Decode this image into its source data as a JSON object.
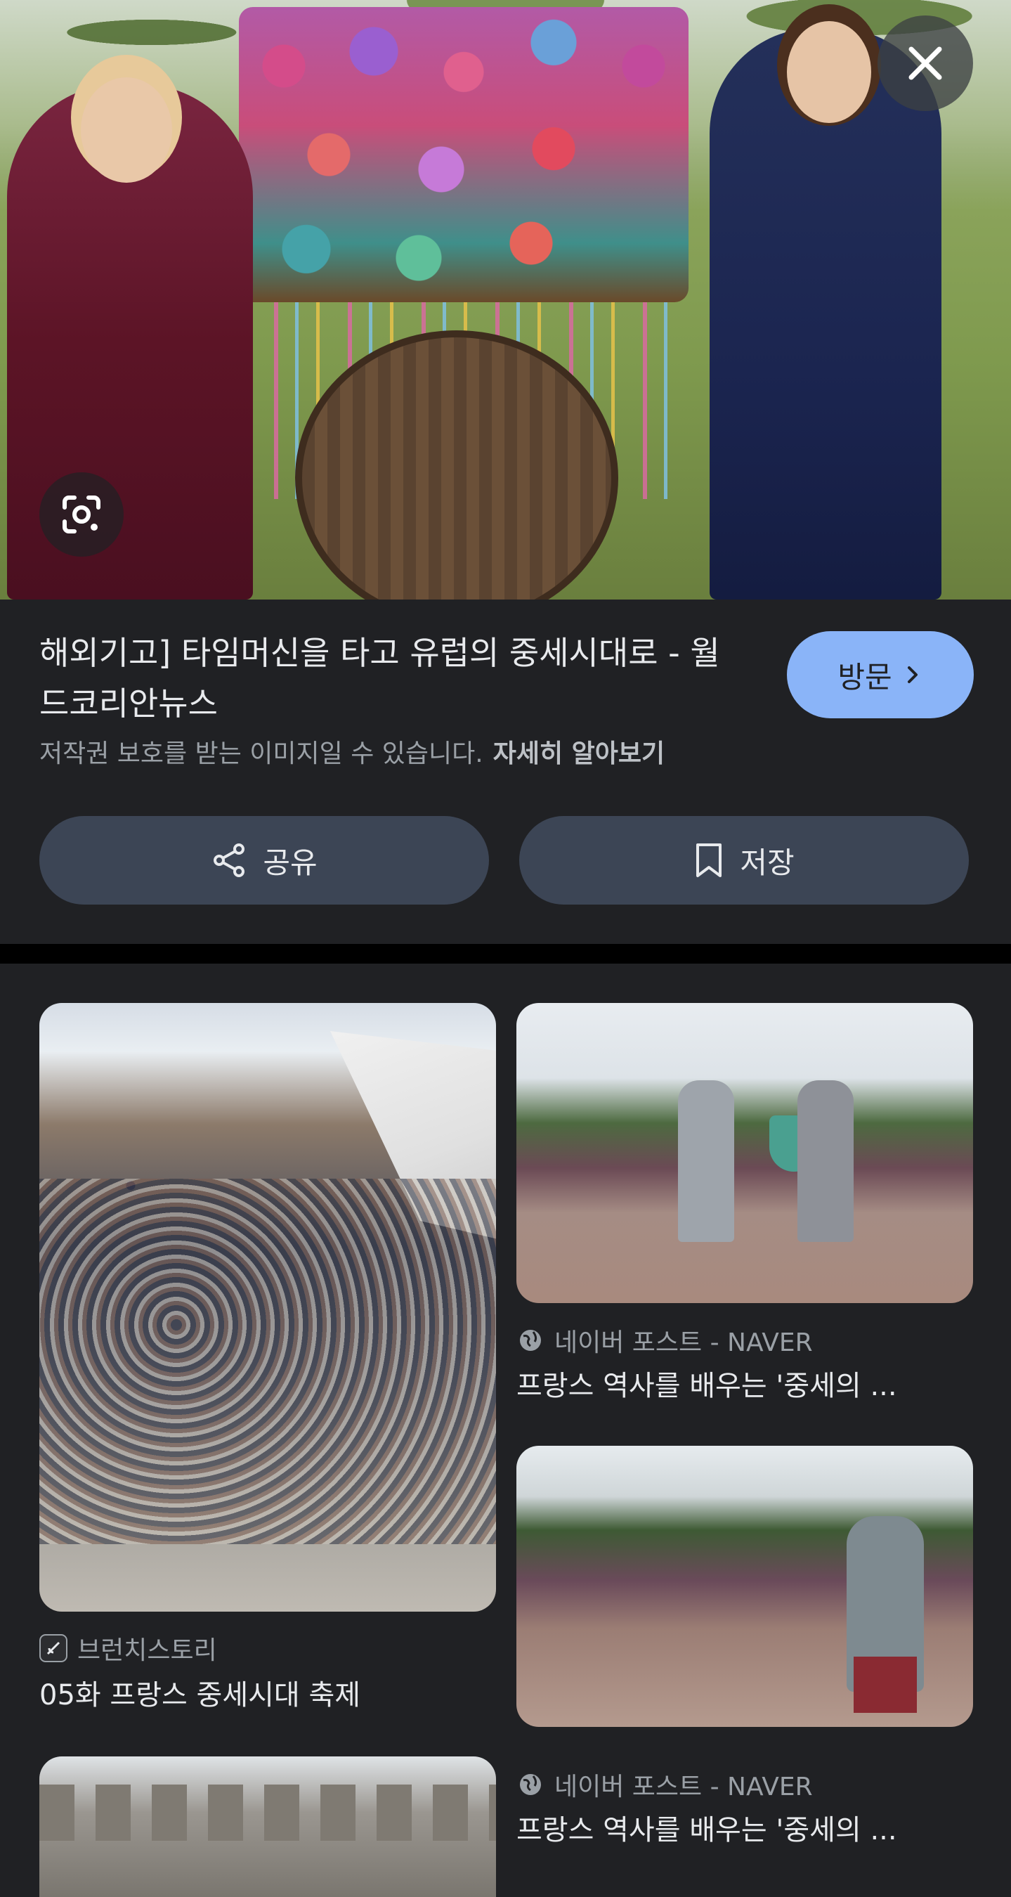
{
  "hero": {
    "description_icons": {
      "lens": "google-lens-icon",
      "close": "close-icon"
    }
  },
  "result": {
    "title": "해외기고] 타임머신을 타고 유럽의 중세시대로 - 월드코리안뉴스",
    "copyright": "저작권 보호를 받는 이미지일 수 있습니다.",
    "learn_more": "자세히 알아보기",
    "visit_label": "방문",
    "share_label": "공유",
    "save_label": "저장"
  },
  "related": [
    {
      "source": "브런치스토리",
      "caption": "05화 프랑스 중세시대 축제"
    },
    {
      "source": "네이버 포스트 - NAVER",
      "caption": "프랑스 역사를 배우는 '중세의 ..."
    },
    {
      "source": "네이버 포스트 - NAVER",
      "caption": "프랑스 역사를 배우는 '중세의 ..."
    }
  ],
  "colors": {
    "background": "#202124",
    "accent": "#8ab4f8",
    "button": "#3c4555"
  }
}
